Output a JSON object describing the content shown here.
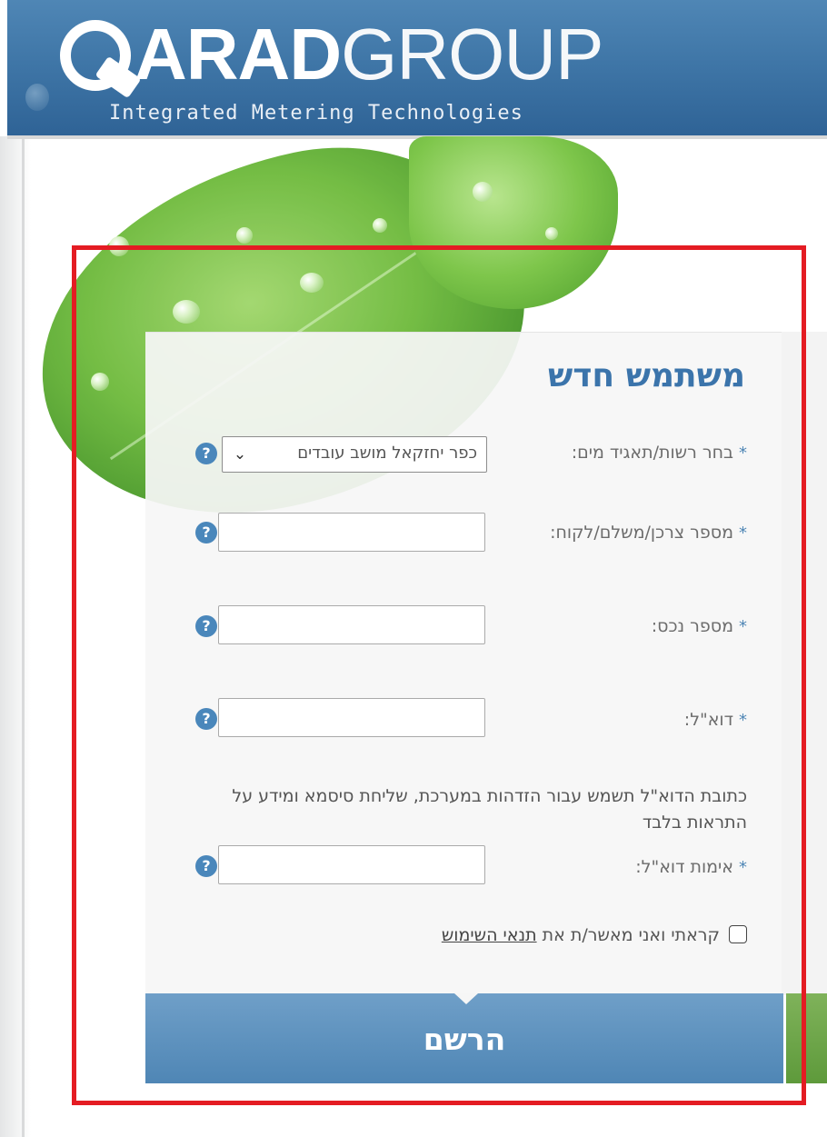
{
  "brand": {
    "logo_bold": "ARAD",
    "logo_light": "GROUP",
    "tagline": "Integrated Metering Technologies",
    "color_header": "#3f76a7",
    "color_accent": "#4f86b5"
  },
  "form": {
    "title": "משתמש חדש",
    "fields": {
      "authority": {
        "label": "בחר רשות/תאגיד מים:",
        "selected": "כפר יחזקאל מושב עובדים",
        "arrow_icon": "chevron-down-icon"
      },
      "consumer_number": {
        "label": "מספר צרכן/משלם/לקוח:",
        "value": ""
      },
      "asset_number": {
        "label": "מספר נכס:",
        "value": ""
      },
      "email": {
        "label": "דוא\"ל:",
        "value": ""
      },
      "email_confirm": {
        "label": "אימות דוא\"ל:",
        "value": ""
      }
    },
    "required_marker": "*",
    "help_icon": "question-icon",
    "help_glyph": "?",
    "email_note": "כתובת הדוא\"ל תשמש עבור הזדהות במערכת, שליחת סיסמא ומידע על התראות בלבד",
    "terms": {
      "prefix": "קראתי ואני מאשר/ת את",
      "link": "תנאי השימוש",
      "checked": false
    },
    "submit_label": "הרשם"
  },
  "annotation_color": "#e41c23"
}
